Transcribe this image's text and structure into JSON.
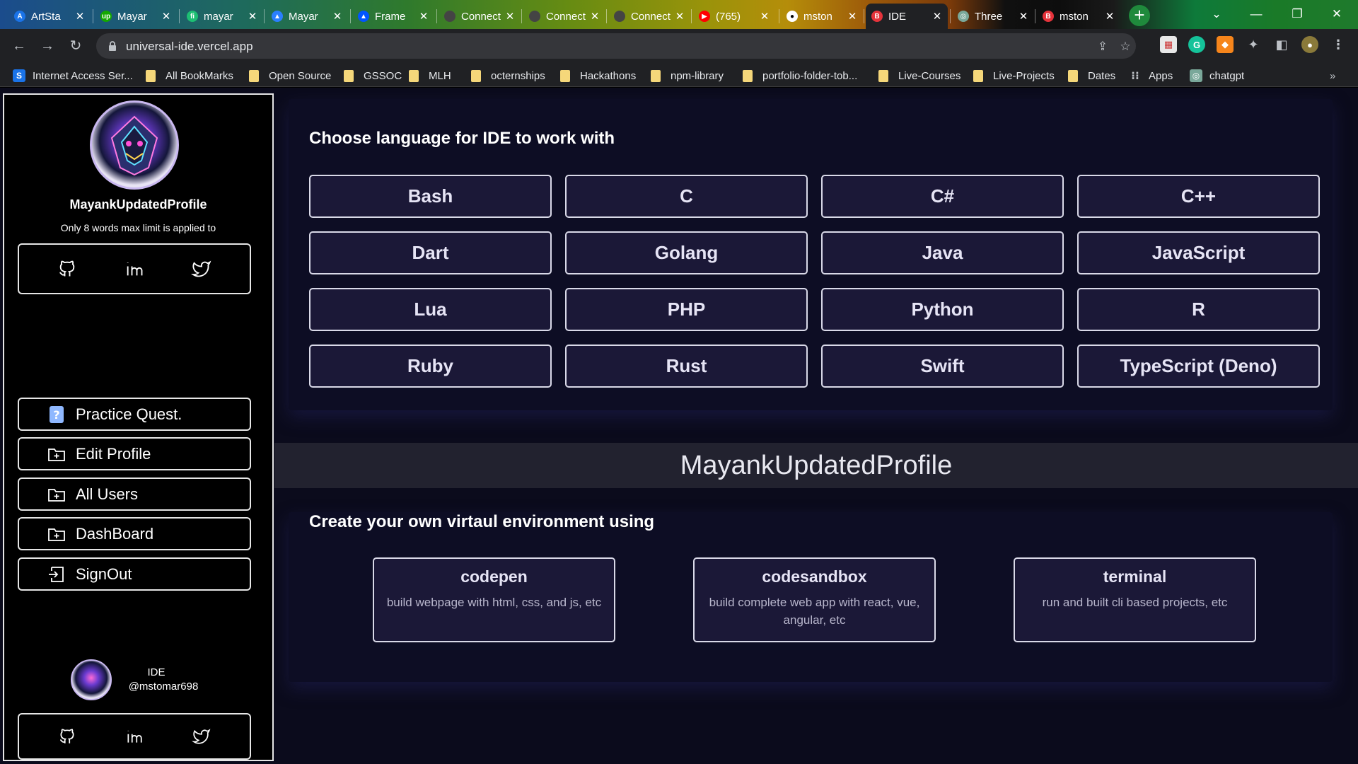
{
  "browser": {
    "tabs": [
      {
        "title": "ArtSta",
        "icon": "artstation-icon",
        "color": "#1a73e8"
      },
      {
        "title": "Mayar",
        "icon": "upwork-icon",
        "color": "#14a800"
      },
      {
        "title": "mayar",
        "icon": "fiverr-icon",
        "color": "#1dbf73"
      },
      {
        "title": "Mayar",
        "icon": "framer-icon",
        "color": "#2a7fff"
      },
      {
        "title": "Frame",
        "icon": "framer-icon",
        "color": "#0055ff"
      },
      {
        "title": "Connect tc",
        "icon": "page-icon",
        "color": "#444"
      },
      {
        "title": "Connect tc",
        "icon": "page-icon",
        "color": "#444"
      },
      {
        "title": "Connect tc",
        "icon": "page-icon",
        "color": "#444"
      },
      {
        "title": "(765)",
        "icon": "youtube-icon",
        "color": "#ff0000"
      },
      {
        "title": "mston",
        "icon": "github-icon",
        "color": "#ffffff"
      },
      {
        "title": "IDE",
        "icon": "b-icon",
        "color": "#e5333b"
      },
      {
        "title": "Three",
        "icon": "chatgpt-icon",
        "color": "#7aa89a"
      },
      {
        "title": "mston",
        "icon": "b-icon",
        "color": "#e5333b"
      }
    ],
    "active_tab": "IDE",
    "url": "universal-ide.vercel.app",
    "bookmarks": [
      {
        "label": "Internet Access Ser...",
        "type": "site",
        "color": "#1a73e8",
        "glyph": "S"
      },
      {
        "label": "All BookMarks",
        "type": "folder"
      },
      {
        "label": "Open Source",
        "type": "folder"
      },
      {
        "label": "GSSOC",
        "type": "folder"
      },
      {
        "label": "MLH",
        "type": "folder"
      },
      {
        "label": "octernships",
        "type": "folder"
      },
      {
        "label": "Hackathons",
        "type": "folder"
      },
      {
        "label": "npm-library",
        "type": "folder"
      },
      {
        "label": "portfolio-folder-tob...",
        "type": "folder"
      },
      {
        "label": "Live-Courses",
        "type": "folder"
      },
      {
        "label": "Live-Projects",
        "type": "folder"
      },
      {
        "label": "Dates",
        "type": "folder"
      },
      {
        "label": "Apps",
        "type": "apps"
      },
      {
        "label": "chatgpt",
        "type": "site",
        "color": "#7aa89a",
        "glyph": "◎"
      }
    ]
  },
  "sidebar": {
    "profile_name": "MayankUpdatedProfile",
    "bio": "Only 8 words max limit is applied to",
    "menu": [
      {
        "label": "Practice Quest.",
        "icon": "question-file-icon"
      },
      {
        "label": "Edit Profile",
        "icon": "folder-plus-icon"
      },
      {
        "label": "All Users",
        "icon": "folder-plus-icon"
      },
      {
        "label": "DashBoard",
        "icon": "folder-plus-icon"
      },
      {
        "label": "SignOut",
        "icon": "sign-out-icon"
      }
    ],
    "footer": {
      "name": "IDE",
      "handle": "@mstomar698"
    }
  },
  "main": {
    "languages_title": "Choose language for IDE to work with",
    "languages": [
      "Bash",
      "C",
      "C#",
      "C++",
      "Dart",
      "Golang",
      "Java",
      "JavaScript",
      "Lua",
      "PHP",
      "Python",
      "R",
      "Ruby",
      "Rust",
      "Swift",
      "TypeScript (Deno)"
    ],
    "banner": "MayankUpdatedProfile",
    "env_title": "Create your own virtaul environment using",
    "environments": [
      {
        "title": "codepen",
        "desc": "build webpage with html, css, and js, etc"
      },
      {
        "title": "codesandbox",
        "desc": "build complete web app with react, vue, angular, etc"
      },
      {
        "title": "terminal",
        "desc": "run and built cli based projects, etc"
      }
    ]
  },
  "colors": {
    "page_bg": "#0b0b1c",
    "button_bg": "#1b1837",
    "accent_border": "#d9d9e8"
  }
}
